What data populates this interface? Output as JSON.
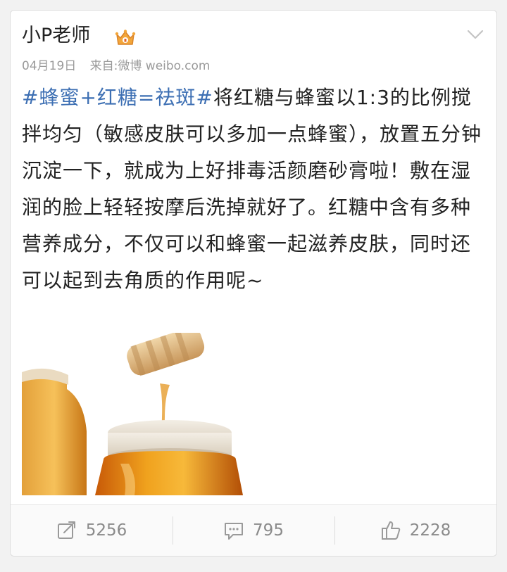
{
  "post": {
    "username": "小P老师",
    "date": "04月19日",
    "source": "来自:微博 weibo.com",
    "topic": "#蜂蜜+红糖=祛斑#",
    "body": "将红糖与蜂蜜以1:3的比例搅拌均匀（敏感皮肤可以多加一点蜂蜜），放置五分钟沉淀一下，就成为上好排毒活颜磨砂膏啦！敷在湿润的脸上轻轻按摩后洗掉就好了。红糖中含有多种营养成分，不仅可以和蜂蜜一起滋养皮肤，同时还可以起到去角质的作用呢~",
    "image_alt": "honey jar with honey dipper"
  },
  "actions": {
    "repost": {
      "icon": "repost-icon",
      "count": "5256"
    },
    "comment": {
      "icon": "comment-icon",
      "count": "795"
    },
    "like": {
      "icon": "thumbs-up-icon",
      "count": "2228"
    }
  },
  "colors": {
    "topic": "#3d6fb3",
    "text": "#222222",
    "meta": "#9a9a9a",
    "crown": "#f3a63a"
  }
}
